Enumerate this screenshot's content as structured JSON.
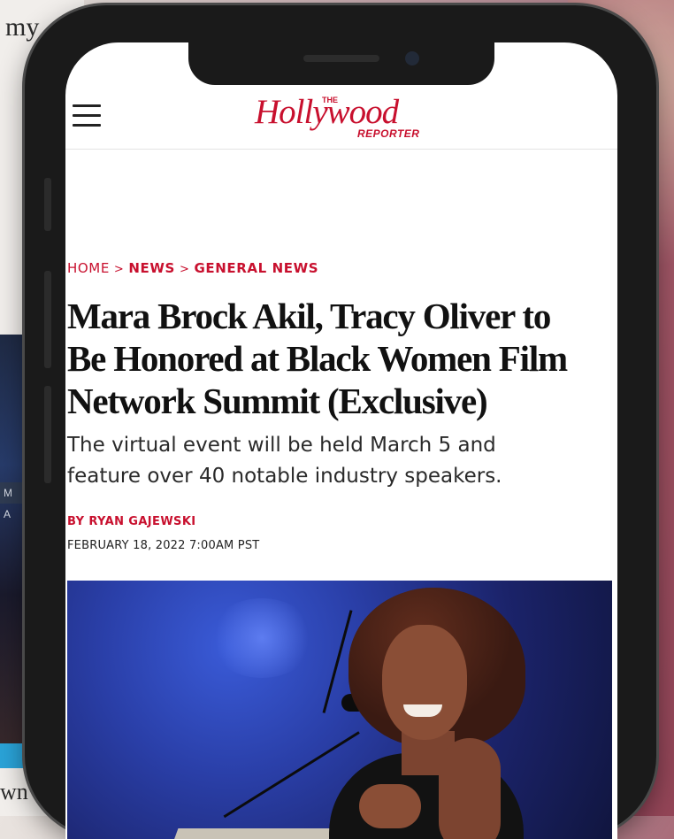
{
  "background": {
    "word_top": "my",
    "word_bottom": "wn",
    "photo_band_text": "M A"
  },
  "site": {
    "logo_main": "Hollywood",
    "logo_the": "THE",
    "logo_reporter": "REPORTER",
    "brand_color": "#c8102e",
    "menu_icon": "hamburger-menu-icon"
  },
  "breadcrumb": {
    "home": "HOME",
    "separator": ">",
    "news": "NEWS",
    "general_news": "GENERAL NEWS"
  },
  "article": {
    "headline_lines": [
      "Mara Brock Akil, Tracy Oliver to",
      "Be Honored at Black Women Film",
      "Network Summit (Exclusive)"
    ],
    "dek_lines": [
      "The virtual event will be held March 5 and",
      "feature over 40 notable industry speakers."
    ],
    "byline": "BY RYAN GAJEWSKI",
    "dateline": "FEBRUARY 18, 2022 7:00AM PST"
  }
}
